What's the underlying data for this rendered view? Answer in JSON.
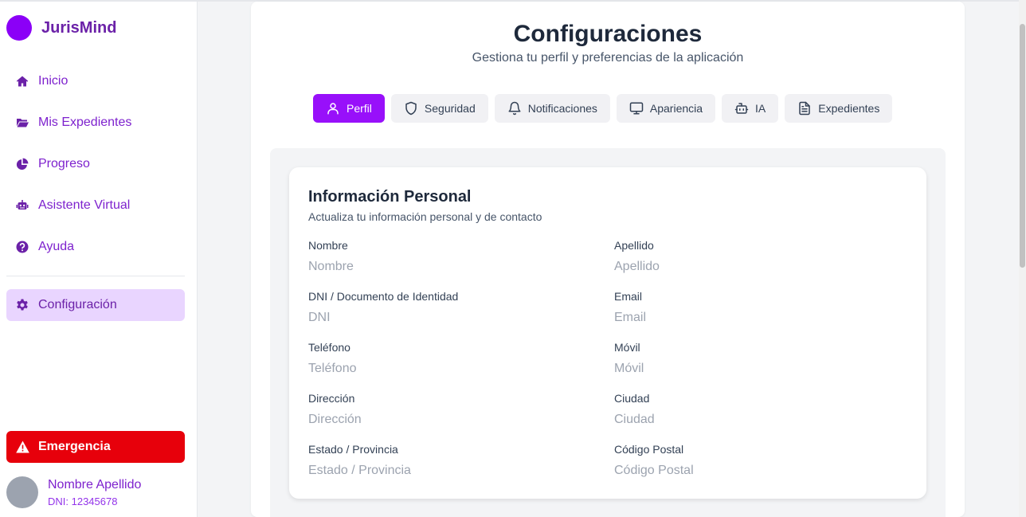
{
  "app": {
    "name": "JurisMind"
  },
  "sidebar": {
    "items": [
      {
        "label": "Inicio",
        "icon": "home-icon"
      },
      {
        "label": "Mis Expedientes",
        "icon": "folder-open-icon"
      },
      {
        "label": "Progreso",
        "icon": "pie-chart-icon"
      },
      {
        "label": "Asistente Virtual",
        "icon": "robot-icon"
      },
      {
        "label": "Ayuda",
        "icon": "question-circle-icon"
      }
    ],
    "config": {
      "label": "Configuración",
      "icon": "gear-icon"
    },
    "emergency": {
      "label": "Emergencia",
      "icon": "warning-triangle-icon",
      "color": "#e7000b"
    },
    "user": {
      "name": "Nombre Apellido",
      "dni": "DNI: 12345678"
    }
  },
  "header": {
    "title": "Configuraciones",
    "subtitle": "Gestiona tu perfil y preferencias de la aplicación"
  },
  "tabs": [
    {
      "label": "Perfil",
      "icon": "user-icon",
      "active": true
    },
    {
      "label": "Seguridad",
      "icon": "shield-icon",
      "active": false
    },
    {
      "label": "Notificaciones",
      "icon": "bell-icon",
      "active": false
    },
    {
      "label": "Apariencia",
      "icon": "monitor-icon",
      "active": false
    },
    {
      "label": "IA",
      "icon": "bot-icon",
      "active": false
    },
    {
      "label": "Expedientes",
      "icon": "file-text-icon",
      "active": false
    }
  ],
  "profile": {
    "title": "Información Personal",
    "subtitle": "Actualiza tu información personal y de contacto",
    "fields": {
      "nombre": {
        "label": "Nombre",
        "placeholder": "Nombre",
        "value": ""
      },
      "apellido": {
        "label": "Apellido",
        "placeholder": "Apellido",
        "value": ""
      },
      "dni": {
        "label": "DNI / Documento de Identidad",
        "placeholder": "DNI",
        "value": ""
      },
      "email": {
        "label": "Email",
        "placeholder": "Email",
        "value": ""
      },
      "telefono": {
        "label": "Teléfono",
        "placeholder": "Teléfono",
        "value": ""
      },
      "movil": {
        "label": "Móvil",
        "placeholder": "Móvil",
        "value": ""
      },
      "direccion": {
        "label": "Dirección",
        "placeholder": "Dirección",
        "value": ""
      },
      "ciudad": {
        "label": "Ciudad",
        "placeholder": "Ciudad",
        "value": ""
      },
      "estado": {
        "label": "Estado / Provincia",
        "placeholder": "Estado / Provincia",
        "value": ""
      },
      "cp": {
        "label": "Código Postal",
        "placeholder": "Código Postal",
        "value": ""
      }
    }
  },
  "colors": {
    "accent": "#9810fa",
    "brand": "#6b21a8",
    "active_nav_bg": "#e9d5ff"
  }
}
